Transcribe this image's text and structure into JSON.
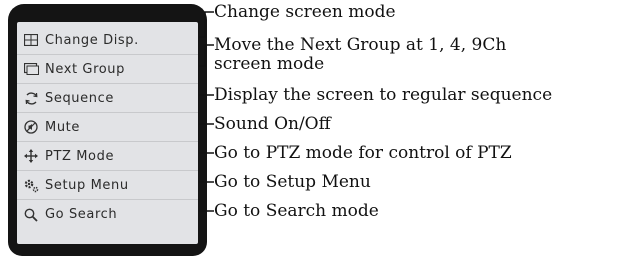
{
  "menu": {
    "items": [
      {
        "key": "change_disp",
        "label": "Change Disp.",
        "icon": "grid-icon",
        "description": "Change screen mode"
      },
      {
        "key": "next_group",
        "label": "Next Group",
        "icon": "monitor-icon",
        "description": "Move the Next Group at 1, 4, 9Ch",
        "description_line2": "screen mode"
      },
      {
        "key": "sequence",
        "label": "Sequence",
        "icon": "sequence-icon",
        "description": "Display the screen to regular sequence"
      },
      {
        "key": "mute",
        "label": "Mute",
        "icon": "mute-icon",
        "description": "Sound On/Off"
      },
      {
        "key": "ptz_mode",
        "label": "PTZ Mode",
        "icon": "ptz-arrows-icon",
        "description": "Go to PTZ mode for control of PTZ"
      },
      {
        "key": "setup_menu",
        "label": "Setup Menu",
        "icon": "gear-icon",
        "description": "Go to Setup Menu"
      },
      {
        "key": "go_search",
        "label": "Go Search",
        "icon": "search-icon",
        "description": "Go to Search mode"
      }
    ]
  },
  "colors": {
    "panel_frame": "#141414",
    "panel_bg": "#e2e3e6",
    "leader_line": "#111111"
  }
}
